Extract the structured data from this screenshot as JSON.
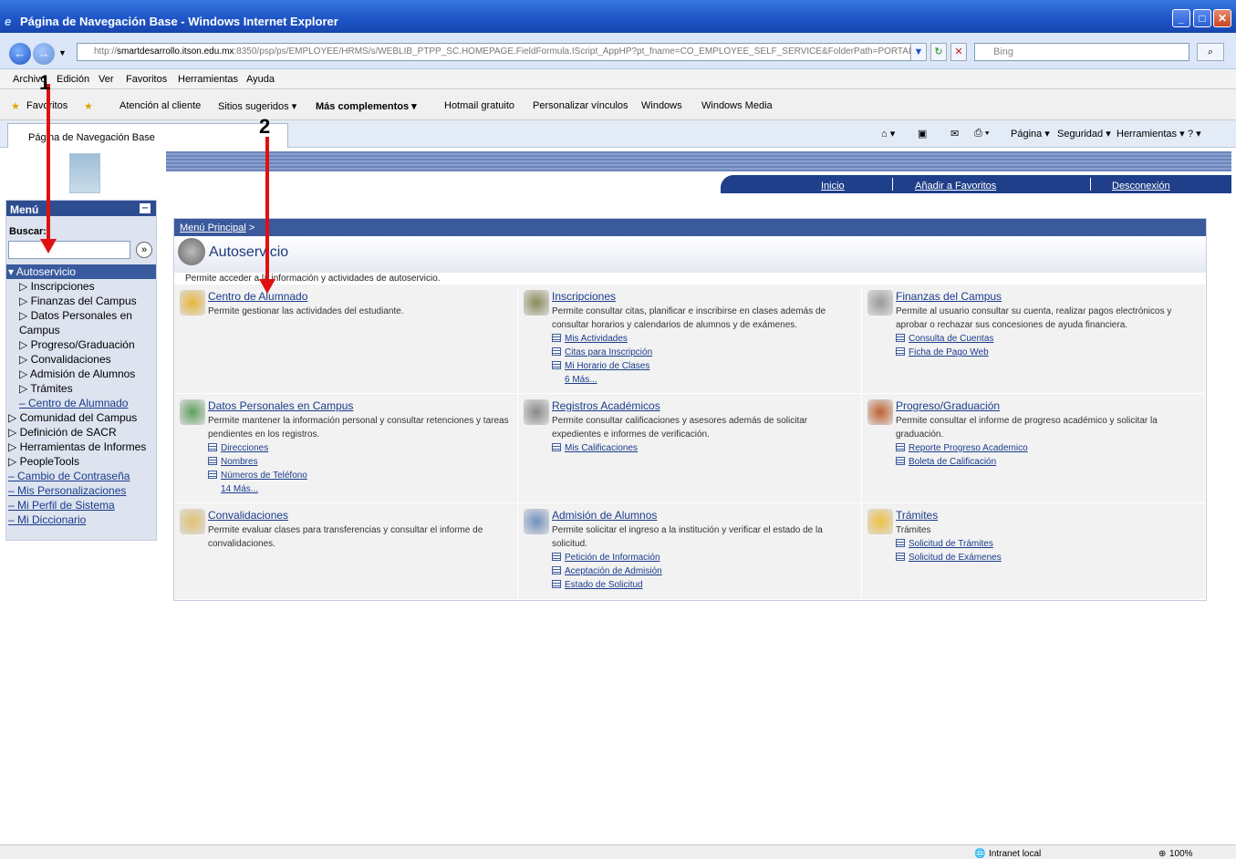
{
  "window": {
    "title": "Página de Navegación Base - Windows Internet Explorer"
  },
  "address": {
    "prefix": "http://",
    "host": "smartdesarrollo.itson.edu.mx",
    "path": ":8350/psp/ps/EMPLOYEE/HRMS/s/WEBLIB_PTPP_SC.HOMEPAGE.FieldFormula.IScript_AppHP?pt_fname=CO_EMPLOYEE_SELF_SERVICE&FolderPath=PORTAL_RC",
    "search_placeholder": "Bing"
  },
  "menubar": [
    "Archivo",
    "Edición",
    "Ver",
    "Favoritos",
    "Herramientas",
    "Ayuda"
  ],
  "favorites_bar": {
    "favorites": "Favoritos",
    "links": [
      "Atención al cliente",
      "Sitios sugeridos ▾",
      "Más complementos ▾",
      "Hotmail gratuito",
      "Personalizar vínculos",
      "Windows",
      "Windows Media"
    ]
  },
  "tab": {
    "label": "Página de Navegación Base"
  },
  "tab_tools": [
    "Página ▾",
    "Seguridad ▾",
    "Herramientas ▾"
  ],
  "header_links": {
    "inicio": "Inicio",
    "favoritos": "Añadir a Favoritos",
    "desconexion": "Desconexión"
  },
  "menu": {
    "title": "Menú",
    "buscar": "Buscar:",
    "items": [
      {
        "label": "▾ Autoservicio",
        "kind": "sel"
      },
      {
        "label": "▷ Inscripciones",
        "kind": "sub"
      },
      {
        "label": "▷ Finanzas del Campus",
        "kind": "sub"
      },
      {
        "label": "▷ Datos Personales en",
        "kind": "sub"
      },
      {
        "label": "   Campus",
        "kind": "sub"
      },
      {
        "label": "▷ Progreso/Graduación",
        "kind": "sub"
      },
      {
        "label": "▷ Convalidaciones",
        "kind": "sub"
      },
      {
        "label": "▷ Admisión de Alumnos",
        "kind": "sub"
      },
      {
        "label": "▷ Trámites",
        "kind": "sub"
      },
      {
        "label": "– Centro de Alumnado",
        "kind": "sublink"
      },
      {
        "label": "▷ Comunidad del Campus",
        "kind": "top"
      },
      {
        "label": "▷ Definición de SACR",
        "kind": "top"
      },
      {
        "label": "▷ Herramientas de Informes",
        "kind": "top"
      },
      {
        "label": "▷ PeopleTools",
        "kind": "top"
      },
      {
        "label": "– Cambio de Contraseña",
        "kind": "toplink"
      },
      {
        "label": "– Mis Personalizaciones",
        "kind": "toplink"
      },
      {
        "label": "– Mi Perfil de Sistema",
        "kind": "toplink"
      },
      {
        "label": "– Mi Diccionario",
        "kind": "toplink"
      }
    ]
  },
  "page": {
    "breadcrumb": "Menú Principal",
    "breadcrumb_sep": " >",
    "title": "Autoservicio",
    "description": "Permite acceder a la información y actividades de autoservicio."
  },
  "cells": [
    {
      "title": "Centro de Alumnado",
      "desc": "Permite gestionar las actividades del estudiante.",
      "links": [],
      "more": ""
    },
    {
      "title": "Inscripciones",
      "desc": "Permite consultar citas, planificar e inscribirse en clases además de consultar horarios y calendarios de alumnos y de exámenes.",
      "links": [
        "Mis Actividades",
        "Citas para Inscripción",
        "Mi Horario de Clases"
      ],
      "more": "6 Más..."
    },
    {
      "title": "Finanzas del Campus",
      "desc": "Permite al usuario consultar su cuenta, realizar pagos electrónicos y aprobar o rechazar sus concesiones de ayuda financiera.",
      "links": [
        "Consulta de Cuentas",
        "Ficha de Pago Web"
      ],
      "more": ""
    },
    {
      "title": "Datos Personales en Campus",
      "desc": "Permite mantener la información personal y consultar retenciones y tareas pendientes en los registros.",
      "links": [
        "Direcciones",
        "Nombres",
        "Números de Teléfono"
      ],
      "more": "14 Más..."
    },
    {
      "title": "Registros Académicos",
      "desc": "Permite consultar calificaciones y asesores además de solicitar expedientes e informes de verificación.",
      "links": [
        "Mis Calificaciones"
      ],
      "more": ""
    },
    {
      "title": "Progreso/Graduación",
      "desc": "Permite consultar el informe de progreso académico y solicitar la graduación.",
      "links": [
        "Reporte Progreso Academico",
        "Boleta de Calificación"
      ],
      "more": ""
    },
    {
      "title": "Convalidaciones",
      "desc": "Permite evaluar clases para transferencias y consultar el informe de convalidaciones.",
      "links": [],
      "more": ""
    },
    {
      "title": "Admisión de Alumnos",
      "desc": "Permite solicitar el ingreso a la institución y verificar el estado de la solicitud.",
      "links": [
        "Petición de Información",
        "Aceptación de Admisión",
        "Estado de Solicitud"
      ],
      "more": ""
    },
    {
      "title": "Trámites",
      "desc": "Trámites",
      "links": [
        "Solicitud de Trámites",
        "Solicitud de Exámenes"
      ],
      "more": ""
    }
  ],
  "markers": [
    "1",
    "2"
  ],
  "status": {
    "zone": "Intranet local",
    "zoom": "100%"
  },
  "colors": {
    "header_blue": "#1f3f8a",
    "menu_bg": "#dde3ef",
    "arrow_red": "#e01010",
    "link": "#1a3c8c"
  }
}
